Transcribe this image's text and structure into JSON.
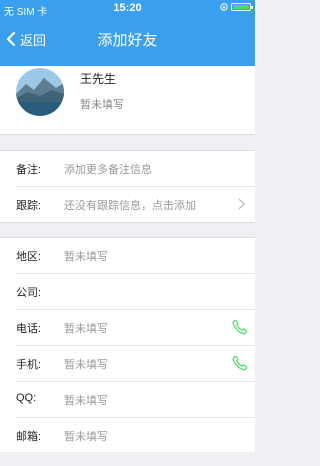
{
  "status": {
    "carrier": "无 SIM 卡",
    "time": "15:20"
  },
  "nav": {
    "back_label": "返回",
    "title": "添加好友"
  },
  "profile": {
    "name": "王先生",
    "subtitle": "暂未填写"
  },
  "remarks": [
    {
      "label": "备注:",
      "value": "添加更多备注信息",
      "icon": null
    },
    {
      "label": "跟踪:",
      "value": "还没有跟踪信息，点击添加",
      "icon": "chevron-right-icon"
    }
  ],
  "details": [
    {
      "label": "地区:",
      "value": "暂未填写",
      "icon": null
    },
    {
      "label": "公司:",
      "value": "",
      "icon": null
    },
    {
      "label": "电话:",
      "value": "暂未填写",
      "icon": "phone-icon"
    },
    {
      "label": "手机:",
      "value": "暂未填写",
      "icon": "phone-icon"
    },
    {
      "label": "QQ:",
      "value": "暂未填写",
      "icon": null
    },
    {
      "label": "邮箱:",
      "value": "暂未填写",
      "icon": null
    }
  ],
  "colors": {
    "accent": "#3aa0ee",
    "phone_icon": "#4cd964"
  }
}
